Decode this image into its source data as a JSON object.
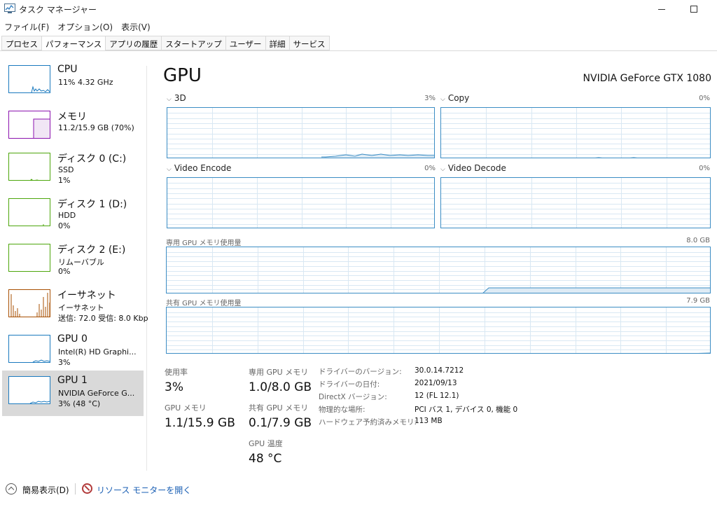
{
  "window": {
    "title": "タスク マネージャー"
  },
  "menu": [
    "ファイル(F)",
    "オプション(O)",
    "表示(V)"
  ],
  "tabs": [
    "プロセス",
    "パフォーマンス",
    "アプリの履歴",
    "スタートアップ",
    "ユーザー",
    "詳細",
    "サービス"
  ],
  "active_tab": "パフォーマンス",
  "sidebar": {
    "items": [
      {
        "title": "CPU",
        "sub1": "11%  4.32 GHz",
        "sub2": "",
        "color": "#1a79be"
      },
      {
        "title": "メモリ",
        "sub1": "11.2/15.9 GB (70%)",
        "sub2": "",
        "color": "#8b12ae"
      },
      {
        "title": "ディスク 0 (C:)",
        "sub1": "SSD",
        "sub2": "1%",
        "color": "#4da60c"
      },
      {
        "title": "ディスク 1 (D:)",
        "sub1": "HDD",
        "sub2": "0%",
        "color": "#4da60c"
      },
      {
        "title": "ディスク 2 (E:)",
        "sub1": "リムーバブル",
        "sub2": "0%",
        "color": "#4da60c"
      },
      {
        "title": "イーサネット",
        "sub1": "イーサネット",
        "sub2": "送信: 72.0  受信: 8.0 Kbp",
        "color": "#a74f01"
      },
      {
        "title": "GPU 0",
        "sub1": "Intel(R) HD Graphi...",
        "sub2": "3%",
        "color": "#1a79be"
      },
      {
        "title": "GPU 1",
        "sub1": "NVIDIA GeForce G...",
        "sub2": "3%  (48 °C)",
        "color": "#1a79be"
      }
    ],
    "selected": "GPU 1"
  },
  "main": {
    "title": "GPU",
    "device": "NVIDIA GeForce GTX 1080",
    "engines": [
      {
        "label": "3D",
        "percent": "3%"
      },
      {
        "label": "Copy",
        "percent": "0%"
      },
      {
        "label": "Video Encode",
        "percent": "0%"
      },
      {
        "label": "Video Decode",
        "percent": "0%"
      }
    ],
    "dedicated_mem": {
      "label": "専用 GPU メモリ使用量",
      "max": "8.0 GB"
    },
    "shared_mem": {
      "label": "共有 GPU メモリ使用量",
      "max": "7.9 GB"
    },
    "graph_color": "#3c8dc4"
  },
  "stats": {
    "utilization": {
      "label": "使用率",
      "value": "3%"
    },
    "dedicated": {
      "label": "専用 GPU メモリ",
      "value": "1.0/8.0 GB"
    },
    "gpu_memory": {
      "label": "GPU メモリ",
      "value": "1.1/15.9 GB"
    },
    "shared": {
      "label": "共有 GPU メモリ",
      "value": "0.1/7.9 GB"
    },
    "temperature": {
      "label": "GPU 温度",
      "value": "48 °C"
    }
  },
  "info": [
    {
      "key": "ドライバーのバージョン:",
      "value": "30.0.14.7212"
    },
    {
      "key": "ドライバーの日付:",
      "value": "2021/09/13"
    },
    {
      "key": "DirectX バージョン:",
      "value": "12 (FL 12.1)"
    },
    {
      "key": "物理的な場所:",
      "value": "PCI バス 1, デバイス 0, 機能 0"
    },
    {
      "key": "ハードウェア予約済みメモリ:",
      "value": "113 MB"
    }
  ],
  "footer": {
    "fewer_details": "簡易表示(D)",
    "resource_monitor": "リソース モニターを開く"
  }
}
